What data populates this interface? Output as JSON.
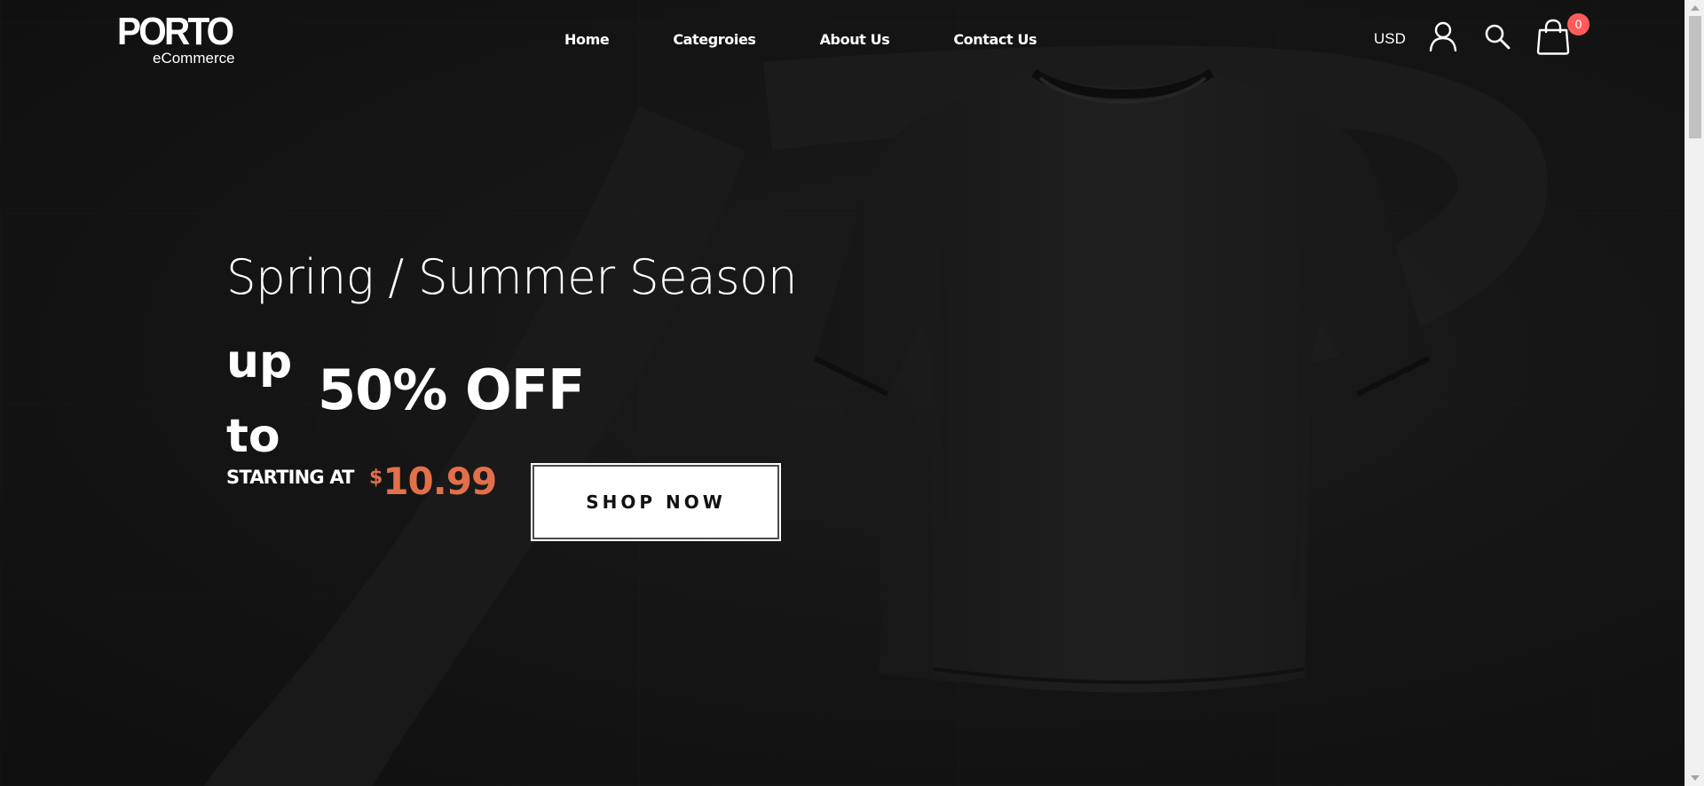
{
  "brand": {
    "name": "PORTO",
    "tagline": "eCommerce"
  },
  "nav": {
    "items": [
      {
        "label": "Home"
      },
      {
        "label": "Categroies"
      },
      {
        "label": "About Us"
      },
      {
        "label": "Contact Us"
      }
    ]
  },
  "header": {
    "currency": "USD",
    "cart_count": "0",
    "icons": [
      "user-icon",
      "search-icon",
      "cart-icon"
    ]
  },
  "hero": {
    "season": "Spring / Summer Season",
    "up": "up",
    "to": "to",
    "discount": "50% OFF",
    "starting_label": "STARTING AT",
    "price_currency": "$",
    "price_amount": "10.99",
    "cta_label": "SHOP NOW"
  },
  "colors": {
    "background": "#141414",
    "accent_price": "#e2704a",
    "badge": "#ff5b5b",
    "text": "#ffffff"
  }
}
